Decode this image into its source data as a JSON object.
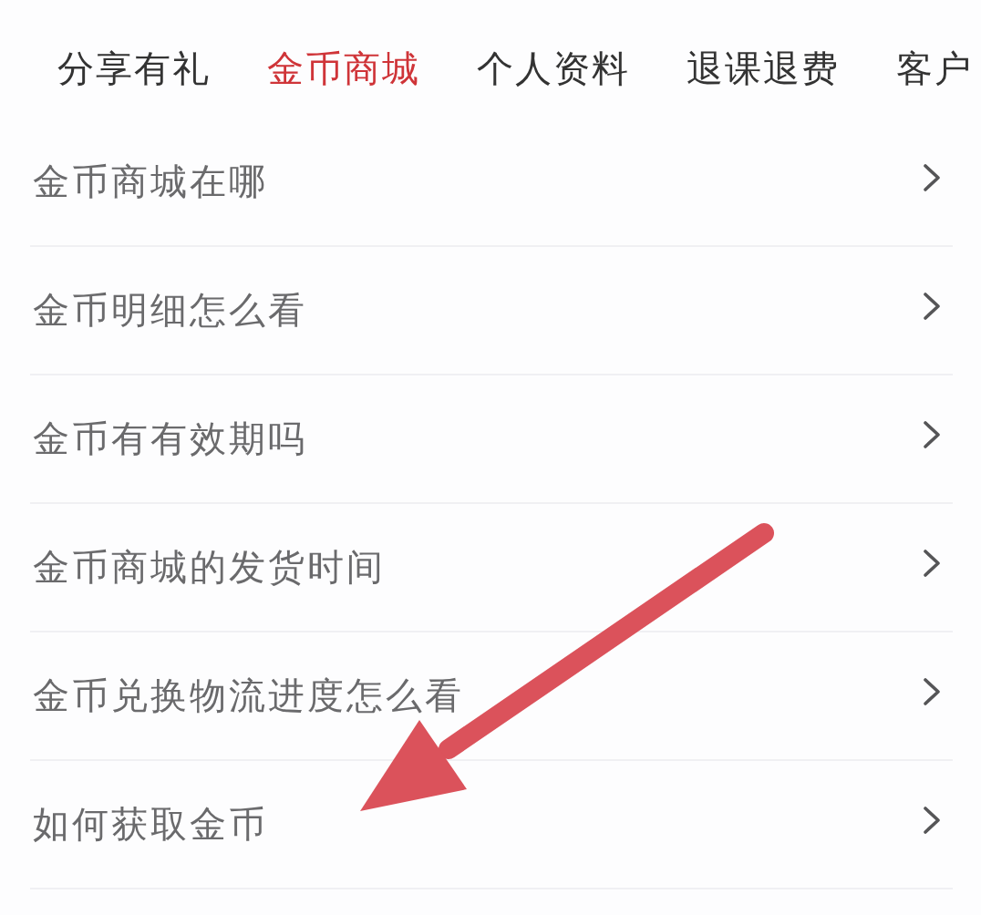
{
  "tabs": [
    {
      "label": "分享有礼",
      "selected": false
    },
    {
      "label": "金币商城",
      "selected": true
    },
    {
      "label": "个人资料",
      "selected": false
    },
    {
      "label": "退课退费",
      "selected": false
    },
    {
      "label": "客户",
      "selected": false
    }
  ],
  "questions": [
    "金币商城在哪",
    "金币明细怎么看",
    "金币有有效期吗",
    "金币商城的发货时间",
    "金币兑换物流进度怎么看",
    "如何获取金币"
  ]
}
